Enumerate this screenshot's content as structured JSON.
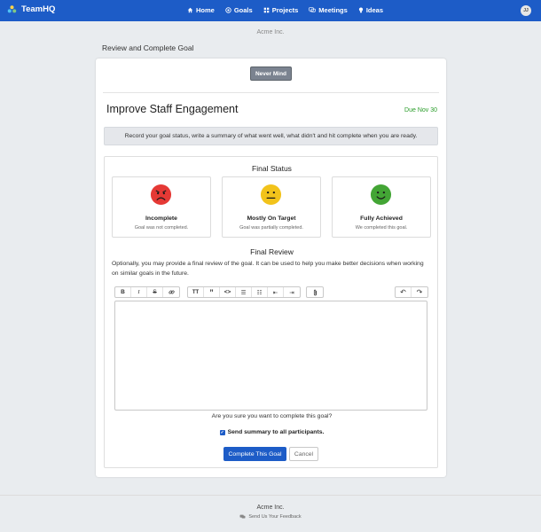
{
  "app": {
    "name": "TeamHQ",
    "user_initials": "JJ"
  },
  "nav": [
    {
      "label": "Home",
      "icon": "home-icon"
    },
    {
      "label": "Goals",
      "icon": "target-icon"
    },
    {
      "label": "Projects",
      "icon": "grid-icon"
    },
    {
      "label": "Meetings",
      "icon": "chat-icon"
    },
    {
      "label": "Ideas",
      "icon": "lightbulb-icon"
    }
  ],
  "org_name": "Acme Inc.",
  "page_title": "Review and Complete Goal",
  "never_mind_label": "Never Mind",
  "goal": {
    "title": "Improve Staff Engagement",
    "due": "Due Nov 30"
  },
  "info_text": "Record your goal status, write a summary of what went well, what didn't and hit complete when you are ready.",
  "final_status": {
    "title": "Final Status",
    "options": [
      {
        "label": "Incomplete",
        "desc": "Goal was not completed.",
        "color": "#e53935"
      },
      {
        "label": "Mostly On Target",
        "desc": "Goal was partially completed.",
        "color": "#f2c31b"
      },
      {
        "label": "Fully Achieved",
        "desc": "We completed this goal.",
        "color": "#43a535"
      }
    ]
  },
  "final_review": {
    "title": "Final Review",
    "description": "Optionally, you may provide a final review of the goal. It can be used to help you make better decisions when working on similar goals in the future.",
    "editor_value": "",
    "toolbar": {
      "bold": "B",
      "italic": "I",
      "strike": "S",
      "link": "🔗",
      "heading": "TT",
      "quote": "”",
      "code": "<>",
      "bullet_list": "☰",
      "number_list": "☷",
      "outdent": "⇤",
      "indent": "⇥",
      "attach": "📎",
      "undo": "↶",
      "redo": "↷"
    }
  },
  "confirm_text": "Are you sure you want to complete this goal?",
  "send_summary_label": "Send summary to all participants.",
  "send_summary_checked": true,
  "complete_label": "Complete This Goal",
  "cancel_label": "Cancel",
  "footer": {
    "org": "Acme Inc.",
    "feedback": "Send Us Your Feedback"
  },
  "colors": {
    "primary": "#1d5cc7",
    "success": "#2a9d2a"
  }
}
